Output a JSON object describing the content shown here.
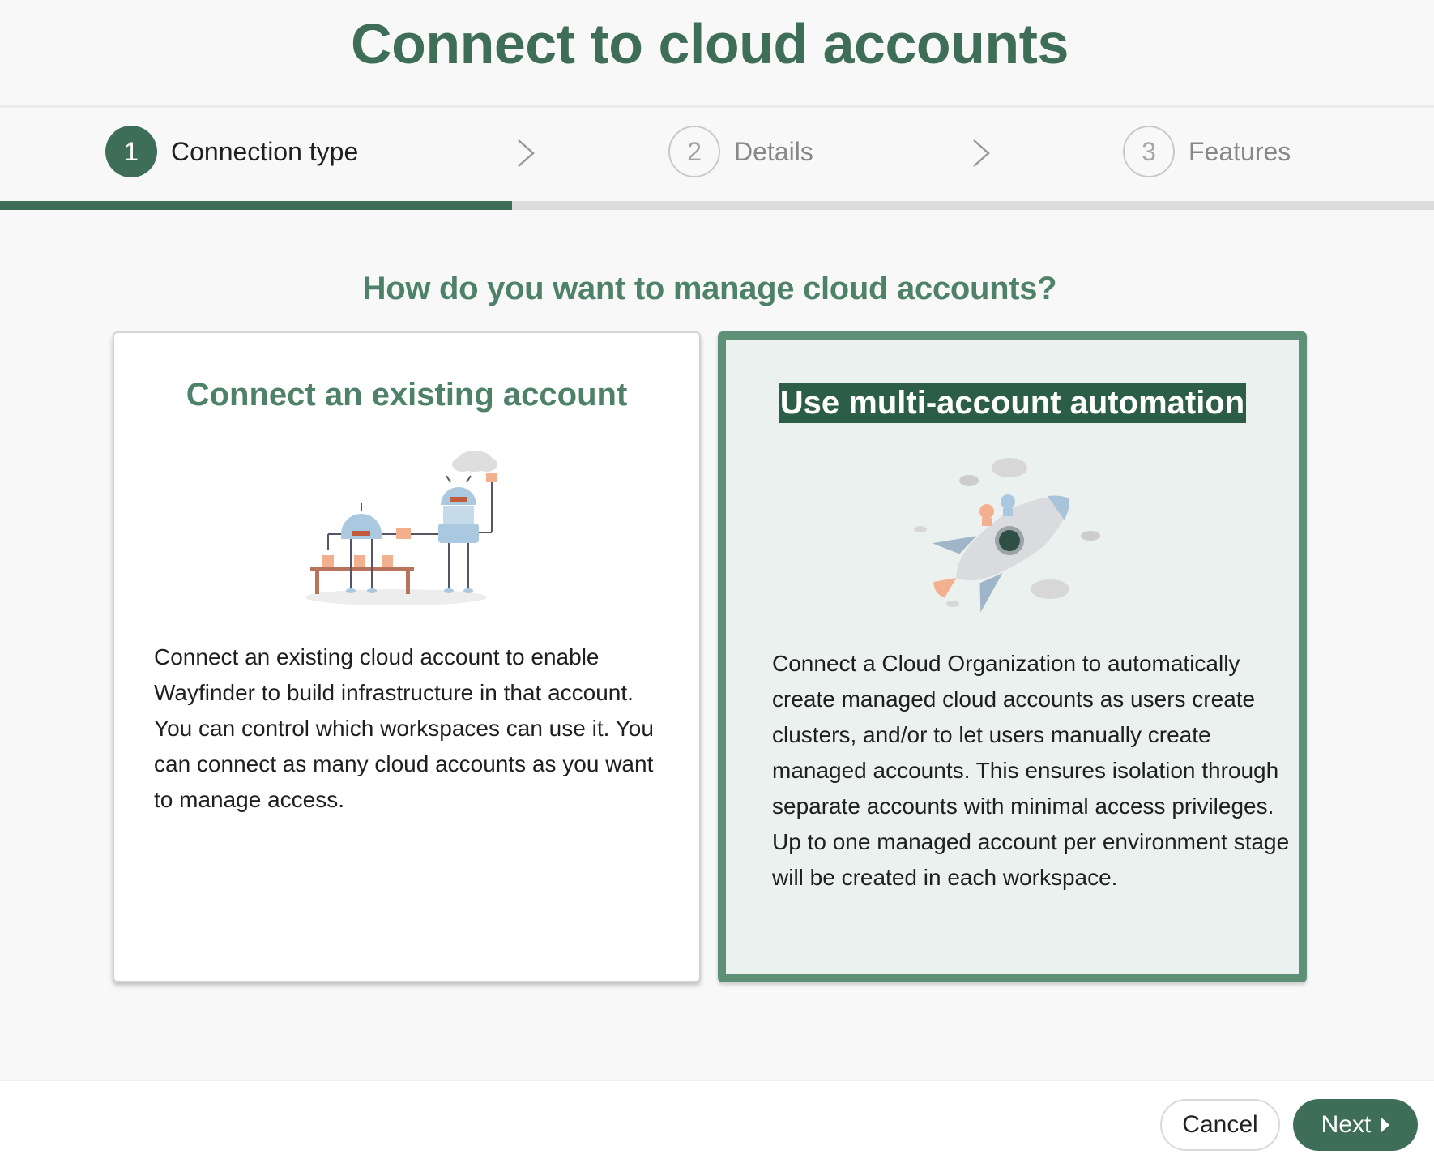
{
  "header": {
    "title": "Connect to cloud accounts"
  },
  "stepper": {
    "steps": [
      {
        "number": "1",
        "label": "Connection type",
        "state": "active"
      },
      {
        "number": "2",
        "label": "Details",
        "state": "inactive"
      },
      {
        "number": "3",
        "label": "Features",
        "state": "inactive"
      }
    ],
    "progress_fraction": 0.357
  },
  "main": {
    "question": "How do you want to manage cloud accounts?",
    "options": [
      {
        "title": "Connect an existing account",
        "illustration_icon": "robots-assembly-illustration",
        "description": "Connect an existing cloud account to enable Wayfinder to build infrastructure in that account. You can control which workspaces can use it. You can connect as many cloud accounts as you want to manage access.",
        "selected": false
      },
      {
        "title": "Use multi-account automation",
        "illustration_icon": "rocket-illustration",
        "description": "Connect a Cloud Organization to automatically create managed cloud accounts as users create clusters, and/or to let users manually create managed accounts. This ensures isolation through separate accounts with minimal access privileges. Up to one managed account per environment stage will be created in each workspace.",
        "selected": true
      }
    ]
  },
  "footer": {
    "cancel_label": "Cancel",
    "next_label": "Next"
  },
  "colors": {
    "brand_green": "#3f6e58",
    "selected_border": "#5e8f77",
    "selected_bg": "#ebf1ee"
  }
}
